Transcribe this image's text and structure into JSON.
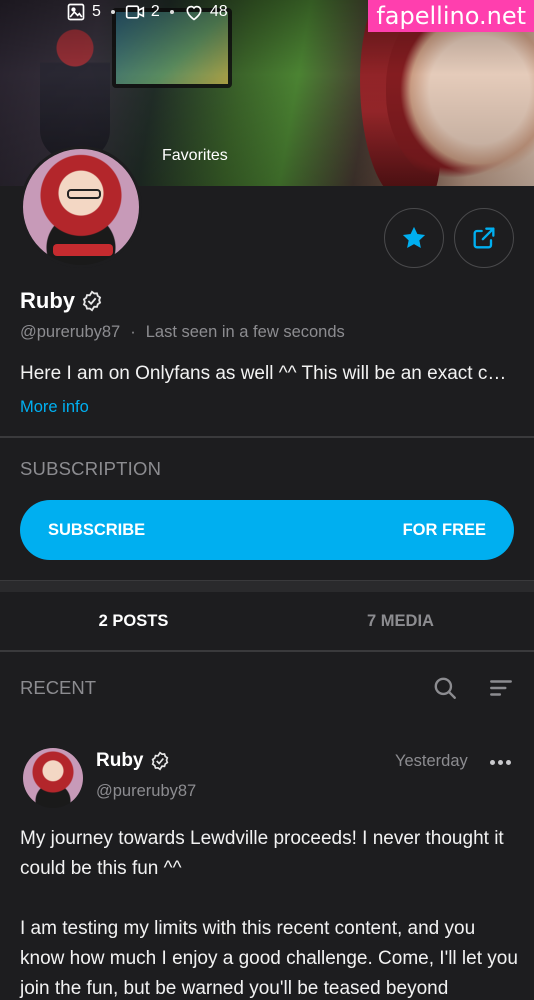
{
  "watermark": "fapellino.net",
  "stats": {
    "photos": "5",
    "videos": "2",
    "likes": "48"
  },
  "banner_label": "Favorites",
  "profile": {
    "name": "Ruby",
    "handle": "@pureruby87",
    "last_seen": "Last seen in a few seconds",
    "bio": "Here I am on Onlyfans as well ^^ This will be an exact copy of my content",
    "more_info": "More info"
  },
  "subscription": {
    "title": "SUBSCRIPTION",
    "subscribe_label": "SUBSCRIBE",
    "price_label": "FOR FREE"
  },
  "tabs": [
    {
      "label": "2 POSTS",
      "active": true
    },
    {
      "label": "7 MEDIA",
      "active": false
    }
  ],
  "recent": {
    "label": "RECENT"
  },
  "post": {
    "author": "Ruby",
    "handle": "@pureruby87",
    "time": "Yesterday",
    "paragraphs": [
      "My journey towards Lewdville proceeds! I never thought it could be this fun ^^",
      "I am testing my limits with this recent content, and you know how much I enjoy a good challenge. Come, I'll let you join the fun, but be warned you'll be teased beyond"
    ]
  },
  "icons": {
    "photo": "image-icon",
    "video": "video-icon",
    "likes": "heart-icon",
    "favorite": "star-icon",
    "share": "share-icon",
    "verified": "verified-badge-icon",
    "search": "search-icon",
    "sort": "sort-icon",
    "more": "more-dots-icon"
  },
  "colors": {
    "accent": "#00aff0",
    "background": "#1d1d1f",
    "muted": "#8c8c90",
    "watermark": "#ff3fae"
  }
}
